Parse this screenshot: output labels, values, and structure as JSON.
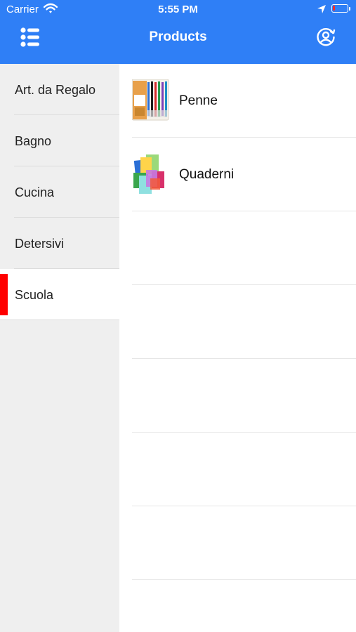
{
  "status_bar": {
    "carrier": "Carrier",
    "time": "5:55 PM",
    "battery_level_fraction": 0.1
  },
  "header": {
    "title": "Products",
    "menu_icon": "list-bullets-icon",
    "profile_icon": "user-circle-icon"
  },
  "colors": {
    "accent": "#2f7ff6",
    "active_marker": "#ff0000",
    "sidebar_bg": "#efefef"
  },
  "sidebar": {
    "selected": "Scuola",
    "items": [
      {
        "label": "Art. da Regalo"
      },
      {
        "label": "Bagno"
      },
      {
        "label": "Cucina"
      },
      {
        "label": "Detersivi"
      },
      {
        "label": "Scuola"
      }
    ]
  },
  "products": {
    "items": [
      {
        "label": "Penne",
        "icon": "pens-pack-image"
      },
      {
        "label": "Quaderni",
        "icon": "notebooks-image"
      }
    ]
  }
}
